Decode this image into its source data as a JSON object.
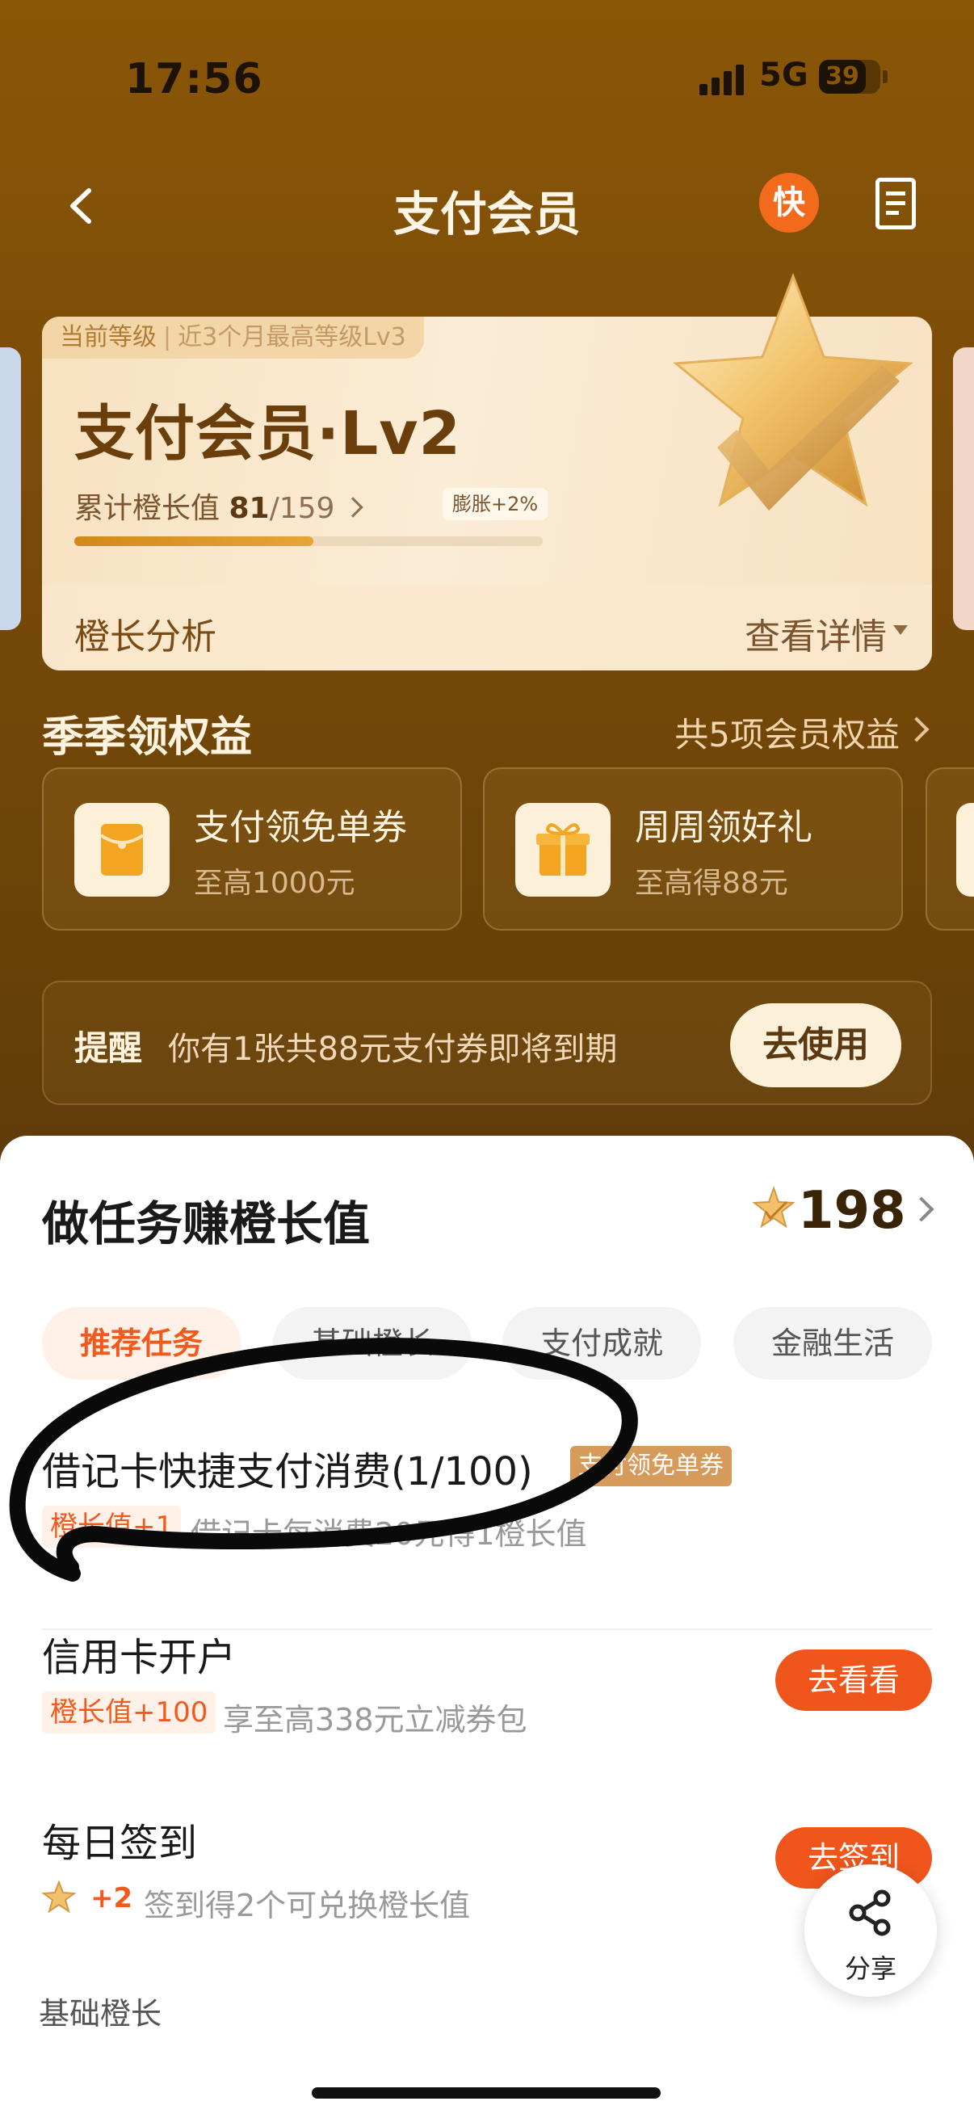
{
  "status_bar": {
    "time": "17:56",
    "network": "5G",
    "battery": "39"
  },
  "nav": {
    "title": "支付会员",
    "kuai_badge": "快"
  },
  "member_card": {
    "level_tag": "当前等级",
    "level_history": "近3个月最高等级Lv3",
    "title": "支付会员·Lv2",
    "growth_label": "累计橙长值",
    "growth_current": "81",
    "growth_total": "/159",
    "expand_badge": "膨胀+2%",
    "progress_fraction": 0.51,
    "analysis_label": "橙长分析",
    "view_detail": "查看详情"
  },
  "benefits": {
    "title": "季季领权益",
    "more": "共5项会员权益",
    "items": [
      {
        "name": "支付领免单券",
        "sub": "至高1000元",
        "icon": "envelope-icon"
      },
      {
        "name": "周周领好礼",
        "sub": "至高得88元",
        "icon": "gift-icon"
      }
    ]
  },
  "reminder": {
    "label": "提醒",
    "text": "你有1张共88元支付券即将到期",
    "button": "去使用"
  },
  "tasks_section": {
    "title": "做任务赚橙长值",
    "points": "198",
    "tabs": [
      {
        "label": "推荐任务",
        "active": true
      },
      {
        "label": "基础橙长",
        "active": false
      },
      {
        "label": "支付成就",
        "active": false
      },
      {
        "label": "金融生活",
        "active": false
      }
    ],
    "tasks": [
      {
        "title": "借记卡快捷支付消费(1/100)",
        "tag": "支付领免单券",
        "badge": "橙长值+1",
        "desc": "借记卡每消费20元得1橙长值",
        "button": ""
      },
      {
        "title": "信用卡开户",
        "tag": "",
        "badge": "橙长值+100",
        "desc": "享至高338元立减券包",
        "button": "去看看"
      },
      {
        "title": "每日签到",
        "tag": "",
        "badge": "+2",
        "desc": "签到得2个可兑换橙长值",
        "button": "去签到"
      }
    ],
    "footer": "基础橙长"
  },
  "share": {
    "label": "分享"
  },
  "colors": {
    "brand_orange": "#f0561c",
    "header_brown": "#7a4b09",
    "card_cream": "#fbecd6"
  }
}
